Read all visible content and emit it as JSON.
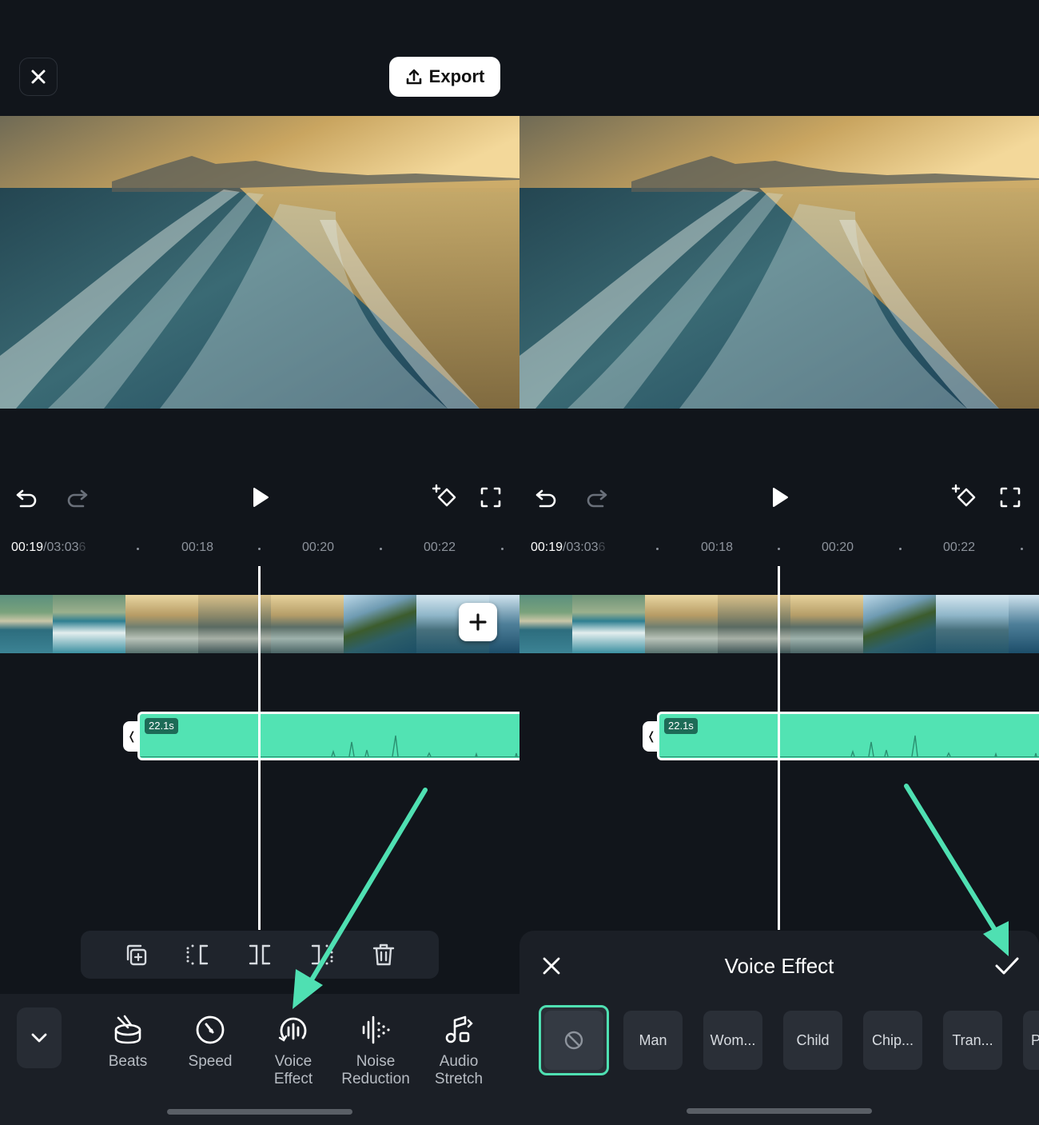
{
  "left_panel": {
    "export_label": "Export",
    "ruler": {
      "current_time": "00:19",
      "total_time": "/03:03",
      "total_time_suffix": "6",
      "ticks": [
        "00:18",
        "00:20",
        "00:22"
      ]
    },
    "audio_duration": "22.1s",
    "tabs": [
      {
        "label": "Beats",
        "icon": "beats-icon"
      },
      {
        "label": "Speed",
        "icon": "speed-icon"
      },
      {
        "label": "Voice\nEffect",
        "icon": "voice-effect-icon"
      },
      {
        "label": "Noise\nReduction",
        "icon": "noise-reduction-icon"
      },
      {
        "label": "Audio\nStretch",
        "icon": "audio-stretch-icon"
      }
    ],
    "tab_labels": {
      "beats": "Beats",
      "speed": "Speed",
      "voice_1": "Voice",
      "voice_2": "Effect",
      "noise_1": "Noise",
      "noise_2": "Reduction",
      "stretch_1": "Audio",
      "stretch_2": "Stretch"
    }
  },
  "right_panel": {
    "ruler": {
      "current_time": "00:19",
      "total_time": "/03:03",
      "total_time_suffix": "6",
      "ticks": [
        "00:18",
        "00:20",
        "00:22"
      ]
    },
    "audio_duration": "22.1s",
    "voice_effect_sheet": {
      "title": "Voice Effect",
      "options": [
        "Man",
        "Wom...",
        "Child",
        "Chip...",
        "Tran...",
        "P"
      ]
    }
  },
  "colors": {
    "background": "#11151b",
    "accent": "#52e3b3",
    "annotation_arrow": "#4fe0b2",
    "panel": "#1b1f26"
  }
}
